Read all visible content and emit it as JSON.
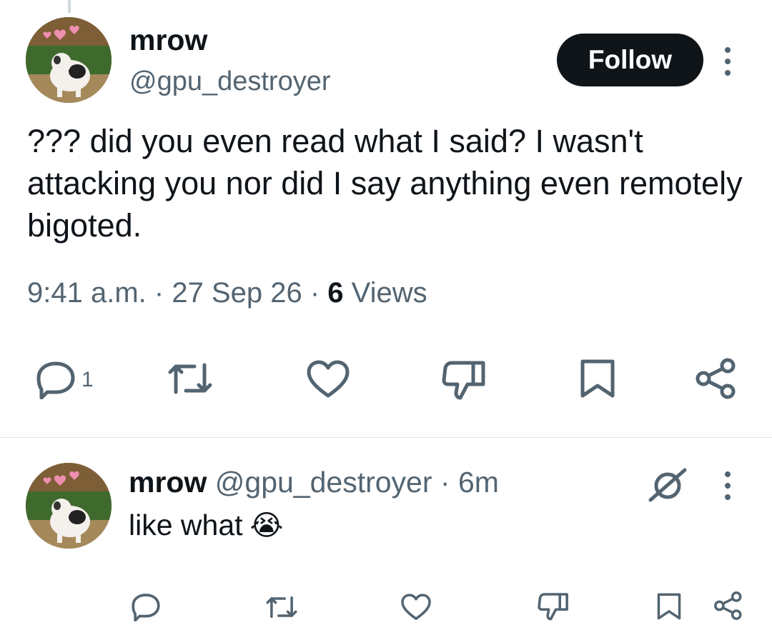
{
  "tweet": {
    "author_name": "mrow",
    "author_handle": "@gpu_destroyer",
    "follow_label": "Follow",
    "text": "??? did you even read what I said? I wasn't attacking you nor did I say anything even remotely bigoted.",
    "time": "9:41 a.m.",
    "date": "27 Sep 26",
    "views_count": "6",
    "views_label": "Views",
    "reply_count": "1"
  },
  "reply": {
    "author_name": "mrow",
    "author_handle": "@gpu_destroyer",
    "age": "6m",
    "text": "like what",
    "emoji": "😭"
  },
  "icons": [
    "reply-icon",
    "retweet-icon",
    "like-icon",
    "dislike-icon",
    "bookmark-icon",
    "share-icon",
    "more-icon",
    "translate-off-icon"
  ],
  "colors": {
    "text": "#0f1419",
    "secondary": "#536471",
    "button_bg": "#0f1419",
    "divider": "#e1e6ea"
  }
}
